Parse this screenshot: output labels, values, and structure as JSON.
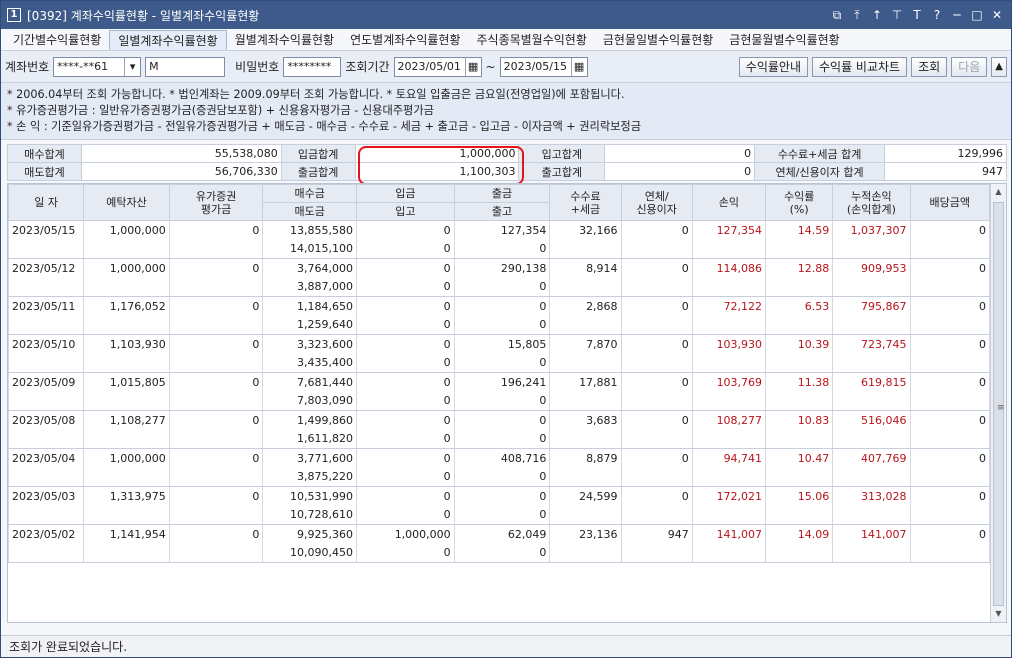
{
  "window": {
    "badge": "1",
    "title": "[0392] 계좌수익률현황 - 일별계좌수익률현황",
    "icons": [
      "link-icon",
      "pin-top-icon",
      "arrow-up-icon",
      "pin-icon",
      "font-icon",
      "help-icon",
      "minimize-icon",
      "maximize-icon",
      "close-icon"
    ]
  },
  "tabs": [
    {
      "label": "기간별수익률현황"
    },
    {
      "label": "일별계좌수익률현황"
    },
    {
      "label": "월별계좌수익률현황"
    },
    {
      "label": "연도별계좌수익률현황"
    },
    {
      "label": "주식종목별월수익현황"
    },
    {
      "label": "금현물일별수익률현황"
    },
    {
      "label": "금현물월별수익률현황"
    }
  ],
  "query": {
    "account_label": "계좌번호",
    "account_value": "****-**61",
    "account_name": "M",
    "password_label": "비밀번호",
    "password_value": "********",
    "period_label": "조회기간",
    "date_from": "2023/05/01",
    "tilde": "~",
    "date_to": "2023/05/15",
    "btn_guide": "수익률안내",
    "btn_compare": "수익률 비교차트",
    "btn_search": "조회",
    "btn_next": "다음",
    "btn_up": "▲"
  },
  "notes": [
    "* 2006.04부터 조회 가능합니다.   * 법인계좌는 2009.09부터 조회 가능합니다.   * 토요일 입출금은 금요일(전영업일)에 포함됩니다.",
    "* 유가증권평가금 : 일반유가증권평가금(증권담보포함) + 신용융자평가금 - 신용대주평가금",
    "* 손        익 : 기준일유가증권평가금 - 전일유가증권평가금 + 매도금 - 매수금 - 수수료 - 세금 + 출고금 - 입고금 - 이자금액 + 권리락보정금"
  ],
  "summary": {
    "r1": [
      {
        "label": "매수합계",
        "value": "55,538,080"
      },
      {
        "label": "입금합계",
        "value": "1,000,000"
      },
      {
        "label": "입고합계",
        "value": "0"
      },
      {
        "label": "수수료+세금 합계",
        "value": "129,996"
      }
    ],
    "r2": [
      {
        "label": "매도합계",
        "value": "56,706,330"
      },
      {
        "label": "출금합계",
        "value": "1,100,303"
      },
      {
        "label": "출고합계",
        "value": "0"
      },
      {
        "label": "연체/신용이자 합계",
        "value": "947"
      }
    ]
  },
  "grid": {
    "headers": {
      "date": "일 자",
      "deposit": "예탁자산",
      "securities": "유가증권\n평가금",
      "buy": "매수금",
      "sell": "매도금",
      "in_cash": "입금",
      "in_stock": "입고",
      "out_cash": "출금",
      "out_stock": "출고",
      "fee": "수수료\n+세금",
      "interest": "연체/\n신용이자",
      "pnl": "손익",
      "rate": "수익률\n(%)",
      "cum_pnl": "누적손익\n(손익합계)",
      "dividend": "배당금액"
    },
    "rows": [
      {
        "date": "2023/05/15",
        "deposit": "1,000,000",
        "securities": "0",
        "buy": "13,855,580",
        "sell": "14,015,100",
        "in_cash": "0",
        "in_stock": "0",
        "out_cash": "127,354",
        "out_stock": "0",
        "fee": "32,166",
        "interest": "0",
        "pnl": "127,354",
        "rate": "14.59",
        "cum_pnl": "1,037,307",
        "dividend": "0"
      },
      {
        "date": "2023/05/12",
        "deposit": "1,000,000",
        "securities": "0",
        "buy": "3,764,000",
        "sell": "3,887,000",
        "in_cash": "0",
        "in_stock": "0",
        "out_cash": "290,138",
        "out_stock": "0",
        "fee": "8,914",
        "interest": "0",
        "pnl": "114,086",
        "rate": "12.88",
        "cum_pnl": "909,953",
        "dividend": "0"
      },
      {
        "date": "2023/05/11",
        "deposit": "1,176,052",
        "securities": "0",
        "buy": "1,184,650",
        "sell": "1,259,640",
        "in_cash": "0",
        "in_stock": "0",
        "out_cash": "0",
        "out_stock": "0",
        "fee": "2,868",
        "interest": "0",
        "pnl": "72,122",
        "rate": "6.53",
        "cum_pnl": "795,867",
        "dividend": "0"
      },
      {
        "date": "2023/05/10",
        "deposit": "1,103,930",
        "securities": "0",
        "buy": "3,323,600",
        "sell": "3,435,400",
        "in_cash": "0",
        "in_stock": "0",
        "out_cash": "15,805",
        "out_stock": "0",
        "fee": "7,870",
        "interest": "0",
        "pnl": "103,930",
        "rate": "10.39",
        "cum_pnl": "723,745",
        "dividend": "0"
      },
      {
        "date": "2023/05/09",
        "deposit": "1,015,805",
        "securities": "0",
        "buy": "7,681,440",
        "sell": "7,803,090",
        "in_cash": "0",
        "in_stock": "0",
        "out_cash": "196,241",
        "out_stock": "0",
        "fee": "17,881",
        "interest": "0",
        "pnl": "103,769",
        "rate": "11.38",
        "cum_pnl": "619,815",
        "dividend": "0"
      },
      {
        "date": "2023/05/08",
        "deposit": "1,108,277",
        "securities": "0",
        "buy": "1,499,860",
        "sell": "1,611,820",
        "in_cash": "0",
        "in_stock": "0",
        "out_cash": "0",
        "out_stock": "0",
        "fee": "3,683",
        "interest": "0",
        "pnl": "108,277",
        "rate": "10.83",
        "cum_pnl": "516,046",
        "dividend": "0"
      },
      {
        "date": "2023/05/04",
        "deposit": "1,000,000",
        "securities": "0",
        "buy": "3,771,600",
        "sell": "3,875,220",
        "in_cash": "0",
        "in_stock": "0",
        "out_cash": "408,716",
        "out_stock": "0",
        "fee": "8,879",
        "interest": "0",
        "pnl": "94,741",
        "rate": "10.47",
        "cum_pnl": "407,769",
        "dividend": "0"
      },
      {
        "date": "2023/05/03",
        "deposit": "1,313,975",
        "securities": "0",
        "buy": "10,531,990",
        "sell": "10,728,610",
        "in_cash": "0",
        "in_stock": "0",
        "out_cash": "0",
        "out_stock": "0",
        "fee": "24,599",
        "interest": "0",
        "pnl": "172,021",
        "rate": "15.06",
        "cum_pnl": "313,028",
        "dividend": "0"
      },
      {
        "date": "2023/05/02",
        "deposit": "1,141,954",
        "securities": "0",
        "buy": "9,925,360",
        "sell": "10,090,450",
        "in_cash": "1,000,000",
        "in_stock": "0",
        "out_cash": "62,049",
        "out_stock": "0",
        "fee": "23,136",
        "interest": "947",
        "pnl": "141,007",
        "rate": "14.09",
        "cum_pnl": "141,007",
        "dividend": "0"
      }
    ]
  },
  "status": {
    "message": "조회가 완료되었습니다."
  },
  "colors": {
    "titlebar": "#3d5a8a",
    "profit": "#b8141b",
    "highlight": "#e4141b"
  }
}
